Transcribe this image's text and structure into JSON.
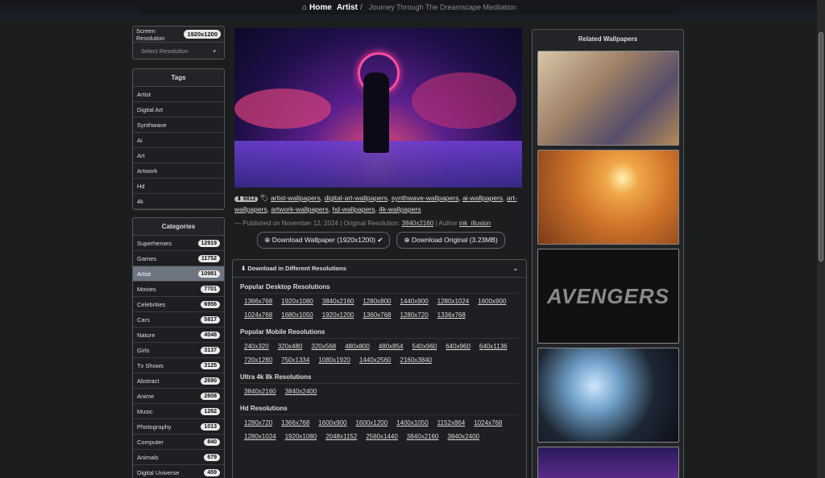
{
  "breadcrumb": {
    "home": "Home",
    "artist": "Artist",
    "current": "Journey Through The Dreamscape Meditation"
  },
  "screen": {
    "label": "Screen Resolution",
    "value": "1920x1200",
    "select": "Select Resolution"
  },
  "tags": {
    "title": "Tags",
    "items": [
      "Artist",
      "Digital Art",
      "Synthwave",
      "Ai",
      "Art",
      "Artwork",
      "Hd",
      "4k"
    ]
  },
  "categories": {
    "title": "Categories",
    "items": [
      {
        "name": "Superheroes",
        "count": "12919"
      },
      {
        "name": "Games",
        "count": "11752"
      },
      {
        "name": "Artist",
        "count": "10981"
      },
      {
        "name": "Movies",
        "count": "7701"
      },
      {
        "name": "Celebrities",
        "count": "6956"
      },
      {
        "name": "Cars",
        "count": "5817"
      },
      {
        "name": "Nature",
        "count": "4048"
      },
      {
        "name": "Girls",
        "count": "3137"
      },
      {
        "name": "Tv Shows",
        "count": "3125"
      },
      {
        "name": "Abstract",
        "count": "2690"
      },
      {
        "name": "Anime",
        "count": "2608"
      },
      {
        "name": "Music",
        "count": "1262"
      },
      {
        "name": "Photography",
        "count": "1013"
      },
      {
        "name": "Computer",
        "count": "840"
      },
      {
        "name": "Animals",
        "count": "679"
      },
      {
        "name": "Digital Universe",
        "count": "459"
      }
    ]
  },
  "wallpaper": {
    "downloads": "6812",
    "tag_links": [
      "artist-wallpapers",
      "digital-art-wallpapers",
      "synthwave-wallpapers",
      "ai-wallpapers",
      "art-wallpapers",
      "artwork-wallpapers",
      "hd-wallpapers",
      "4k-wallpapers"
    ],
    "published": "— Published on November 12, 2024 | Original Resolution:",
    "original_res": "3840x2160",
    "author_label": "| Author",
    "author": "ink_illusion",
    "download_btn": "Download Wallpaper (1920x1200)",
    "original_btn": "Download Original (3.23MB)"
  },
  "resolutions": {
    "title": "Download in Different Resolutions",
    "desktop": {
      "title": "Popular Desktop Resolutions",
      "items": [
        "1366x768",
        "1920x1080",
        "3840x2160",
        "1280x800",
        "1440x900",
        "1280x1024",
        "1600x900",
        "1024x768",
        "1680x1050",
        "1920x1200",
        "1360x768",
        "1280x720",
        "1336x768"
      ]
    },
    "mobile": {
      "title": "Popular Mobile Resolutions",
      "items": [
        "240x320",
        "320x480",
        "320x568",
        "480x800",
        "480x854",
        "540x960",
        "640x960",
        "640x1136",
        "720x1280",
        "750x1334",
        "1080x1920",
        "1440x2560",
        "2160x3840"
      ]
    },
    "ultra": {
      "title": "Ultra 4k 8k Resolutions",
      "items": [
        "3840x2160",
        "3840x2400"
      ]
    },
    "hd": {
      "title": "Hd Resolutions",
      "items": [
        "1280x720",
        "1366x768",
        "1600x900",
        "1600x1200",
        "1400x1050",
        "1152x864",
        "1024x768",
        "1280x1024",
        "1920x1080",
        "2048x1152",
        "2560x1440",
        "3840x2160",
        "3840x2400"
      ]
    }
  },
  "related": {
    "title": "Related Wallpapers",
    "avengers_text": "AVENGERS"
  },
  "colors": {
    "background": "#1c1d1f",
    "active_category": "#6c7580"
  }
}
